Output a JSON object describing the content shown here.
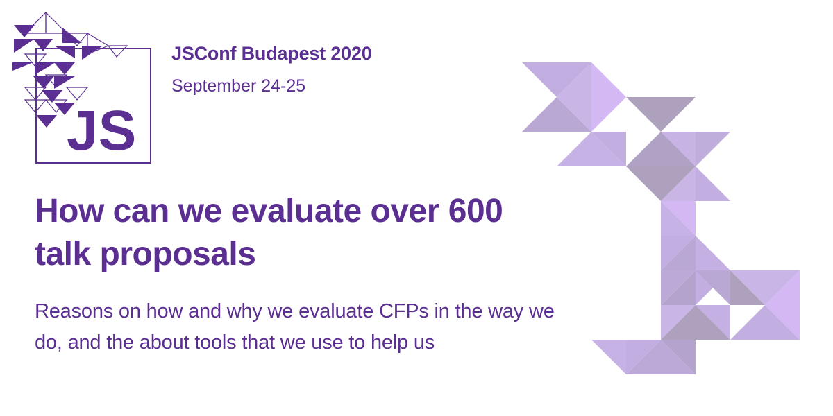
{
  "header": {
    "event_title": "JSConf Budapest 2020",
    "event_date": "September 24-25"
  },
  "logo": {
    "mark_text": "JS",
    "color": "#5b2f91"
  },
  "talk": {
    "title": "How can we evaluate over 600 talk proposals",
    "description": "Reasons on how and why we evaluate CFPs in the way we do, and the about tools that we use to help us"
  },
  "colors": {
    "primary": "#5b2f91",
    "decor_light": "#d4b8f3",
    "decor_mid": "#c2aee0",
    "decor_gray": "#aea1be"
  }
}
